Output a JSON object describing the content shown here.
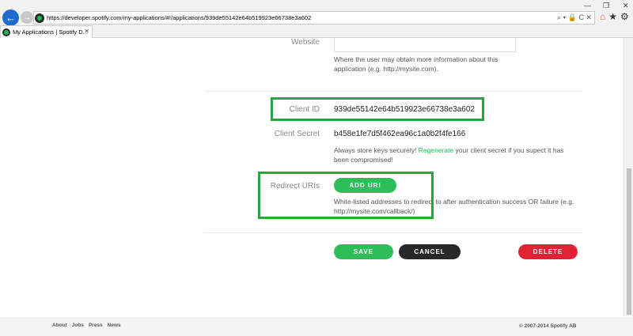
{
  "browser": {
    "url": "https://developer.spotify.com/my-applications/#!/applications/939de55142e64b519923e66738e3a602",
    "tab_title": "My Applications | Spotify D...",
    "back_icon": "arrow-left-icon",
    "forward_icon": "arrow-right-icon",
    "addr_controls": "⌕ ▾ 🔒 C ✕",
    "window_controls": {
      "minimize": "—",
      "maximize": "❐",
      "close": "✕"
    },
    "toolbar_icons": [
      "⌂",
      "★",
      "⚙"
    ]
  },
  "form": {
    "website_label": "Website",
    "website_value": "",
    "website_help": "Where the user may obtain more information about this application (e.g. http://mysite.com).",
    "client_id_label": "Client ID",
    "client_id": "939de55142e64b519923e66738e3a602",
    "client_secret_label": "Client Secret",
    "client_secret": "b458e1fe7d5f462ea96c1a0b2f4fe166",
    "secret_help_before": "Always store keys securely! ",
    "secret_help_link": "Regenerate",
    "secret_help_after": " your client secret if you supect it has been compromised!",
    "redirect_label": "Redirect URIs",
    "add_uri_button": "ADD URI",
    "redirect_help": "White-listed addresses to redirect to after authentication success OR failure (e.g. http://mysite.com/callback/)"
  },
  "actions": {
    "save": "SAVE",
    "cancel": "CANCEL",
    "delete": "DELETE"
  },
  "footer": {
    "links": [
      "About",
      "Jobs",
      "Press",
      "News"
    ],
    "copyright": "© 2007-2014 Spotify AB"
  },
  "colors": {
    "spotify_green": "#2ebd59",
    "danger_red": "#e22134",
    "cancel_dark": "#282828",
    "highlight_green": "#22a83a"
  }
}
